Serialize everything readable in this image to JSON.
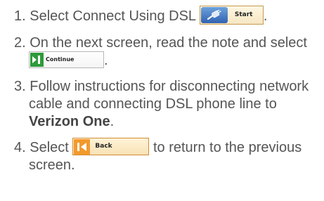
{
  "steps": [
    {
      "number": "1.",
      "text_before": "Select Connect Using DSL",
      "button_label": "Start",
      "button_icon": "dsl-plug-icon",
      "text_after": "."
    },
    {
      "number": "2.",
      "text_before": "On the next screen, read the note and select",
      "button_label": "Continue",
      "button_icon": "continue-arrow-icon",
      "text_after": "."
    },
    {
      "number": "3.",
      "text_before": "Follow instructions for disconnecting network cable and connecting DSL phone line to",
      "bold_text": "Verizon One",
      "text_after": "."
    },
    {
      "number": "4.",
      "text_before": "Select",
      "button_label": "Back",
      "button_icon": "back-arrow-icon",
      "text_after": "to return to the previous screen."
    }
  ],
  "colors": {
    "text": "#555555",
    "start_icon_bg": "#2f62b1",
    "continue_icon_bg": "#2e9a3a",
    "back_icon_bg": "#f29a2c"
  }
}
